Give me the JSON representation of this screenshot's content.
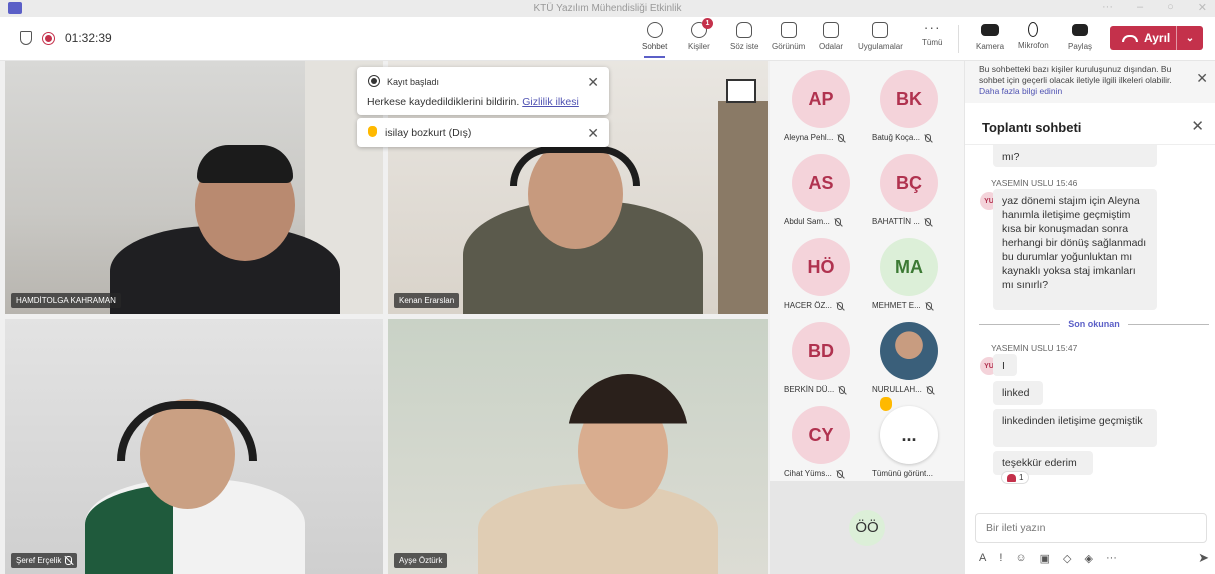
{
  "window": {
    "title": "KTÜ Yazılım Mühendisliği Etkinlik"
  },
  "meeting": {
    "duration": "01:32:39"
  },
  "toolbar": {
    "chat": "Sohbet",
    "people": "Kişiler",
    "people_badge": "1",
    "raise_hand": "Söz iste",
    "view": "Görünüm",
    "rooms": "Odalar",
    "apps": "Uygulamalar",
    "more": "Tümü",
    "camera": "Kamera",
    "mic": "Mikrofon",
    "share": "Paylaş",
    "leave": "Ayrıl"
  },
  "notifications": {
    "recording_title": "Kayıt başladı",
    "recording_text": "Herkese kaydedildiklerini bildirin.",
    "privacy_link": "Gizlilik ilkesi",
    "hand_raised": "isilay bozkurt (Dış)"
  },
  "videos": [
    {
      "name": "HAMDİTOLGA KAHRAMAN"
    },
    {
      "name": "Kenan Erarslan"
    },
    {
      "name": "Şeref Erçelik"
    },
    {
      "name": "Ayşe Öztürk"
    }
  ],
  "participants": [
    {
      "initials": "AP",
      "name": "Aleyna Pehl..."
    },
    {
      "initials": "BK",
      "name": "Batuğ Koça..."
    },
    {
      "initials": "AS",
      "name": "Abdul Sam..."
    },
    {
      "initials": "BÇ",
      "name": "BAHATTİN ..."
    },
    {
      "initials": "HÖ",
      "name": "HACER ÖZ..."
    },
    {
      "initials": "MA",
      "name": "MEHMET E..."
    },
    {
      "initials": "BD",
      "name": "BERKİN DÜ..."
    },
    {
      "initials": "",
      "name": "NURULLAH..."
    },
    {
      "initials": "CY",
      "name": "Cihat Yüms..."
    },
    {
      "initials": "...",
      "name": "Tümünü görünt..."
    }
  ],
  "spotlight_initials": "ÖÖ",
  "chat": {
    "policy": "Bu sohbetteki bazı kişiler kuruluşunuz dışından. Bu sohbet için geçerli olacak iletiyle ilgili ilkeleri olabilir.",
    "policy_link": "Daha fazla bilgi edinin",
    "title": "Toplantı sohbeti",
    "prev_fragment": "mı?",
    "sender1": "YASEMİN USLU  15:46",
    "avatar": "YU",
    "message1": "yaz dönemi stajım için Aleyna hanımla iletişime geçmiştim kısa bir konuşmadan sonra herhangi bir dönüş sağlanmadı bu durumlar yoğunluktan mı kaynaklı yoksa staj imkanları mı sınırlı?",
    "last_read": "Son okunan",
    "sender2": "YASEMİN USLU  15:47",
    "msg_i": "I",
    "msg_linked": "linked",
    "msg_linkedin": "linkedinden iletişime geçmiştik",
    "msg_thanks": "teşekkür ederim",
    "reaction_count": "1",
    "compose_placeholder": "Bir ileti yazın"
  }
}
